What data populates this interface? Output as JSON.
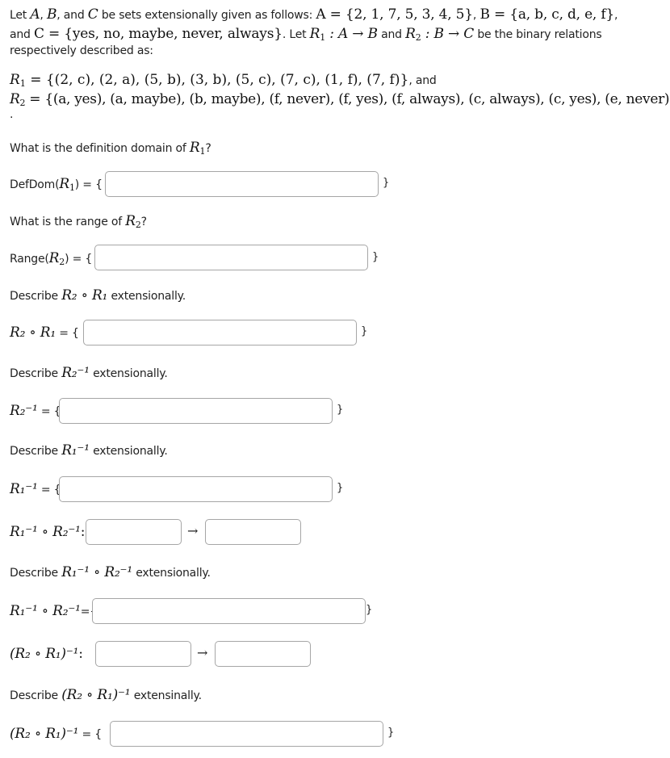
{
  "intro": {
    "line1_prefix": "Let",
    "A": "A",
    "B": "B",
    "C": "C",
    "comma": ",",
    "and_word": "and",
    "be_sets": "be sets extensionally given as follows:",
    "set_A": "A = {2, 1, 7, 5, 3, 4, 5}",
    "set_B": "B = {a, b, c, d, e, f}",
    "line2_and": "and",
    "set_C": "C = {yes, no, maybe, never, always}",
    "let_word": ". Let",
    "r1_sig": "R",
    "r1_sig_rest": " : A → B",
    "and_word2": "and",
    "r2_sig_rest": " : B → C",
    "be_binary": "be the binary relations",
    "line3": "respectively described as:"
  },
  "relations": {
    "R1_label": "R",
    "R1_sub": "1",
    "R1_def": " = {(2, c), (2, a), (5, b), (3, b), (5, c), (7, c), (1, f), (7, f)}",
    "R1_trailing": ", and",
    "R2_label": "R",
    "R2_sub": "2",
    "R2_def": " = {(a, yes), (a, maybe), (b, maybe), (f, never), (f, yes), (f, always), (c, always), (c, yes), (e, never)}",
    "dot": "."
  },
  "questions": [
    {
      "prompt_prefix": "What is the definition domain of",
      "prompt_math": "R",
      "prompt_sub": "1",
      "prompt_suffix": "?",
      "label_prefix": "DefDom(",
      "label_math": "R",
      "label_sub": "1",
      "label_suffix": ") = {",
      "answer_value": "",
      "close": "}"
    },
    {
      "prompt_prefix": "What is the range of",
      "prompt_math": "R",
      "prompt_sub": "2",
      "prompt_suffix": "?",
      "label_prefix": "Range(",
      "label_math": "R",
      "label_sub": "2",
      "label_suffix": ") = {",
      "answer_value": "",
      "close": "}"
    },
    {
      "prompt_prefix": "Describe",
      "prompt_math": "R₂ ∘ R₁",
      "prompt_suffix": "extensionally.",
      "label_math": "R₂ ∘ R₁",
      "label_suffix": " = {",
      "answer_value": "",
      "close": "}"
    },
    {
      "prompt_prefix": "Describe",
      "prompt_math": "R₂⁻¹",
      "prompt_suffix": "extensionally.",
      "label_math": "R₂⁻¹",
      "label_suffix": " = {",
      "answer_value": "",
      "close": "}"
    },
    {
      "prompt_prefix": "Describe",
      "prompt_math": "R₁⁻¹",
      "prompt_suffix": "extensionally.",
      "label_math": "R₁⁻¹",
      "label_suffix": " = {",
      "answer_value": "",
      "close": "}"
    },
    {
      "type": "signature",
      "label_math": "R₁⁻¹ ∘ R₂⁻¹",
      "label_suffix": ":",
      "from_value": "",
      "arrow": "→",
      "to_value": ""
    },
    {
      "prompt_prefix": "Describe",
      "prompt_math": "R₁⁻¹ ∘ R₂⁻¹",
      "prompt_suffix": "extensionally.",
      "label_math": "R₁⁻¹ ∘ R₂⁻¹",
      "label_suffix": "={",
      "answer_value": "",
      "close": "}"
    },
    {
      "type": "signature",
      "label_math": "(R₂ ∘ R₁)⁻¹",
      "label_suffix": ":",
      "from_value": "",
      "arrow": "→",
      "to_value": ""
    },
    {
      "prompt_prefix": "Describe",
      "prompt_math": "(R₂ ∘ R₁)⁻¹",
      "prompt_suffix": "extensinally.",
      "label_math": "(R₂ ∘ R₁)⁻¹",
      "label_suffix": " = {",
      "answer_value": "",
      "close": "}"
    }
  ]
}
